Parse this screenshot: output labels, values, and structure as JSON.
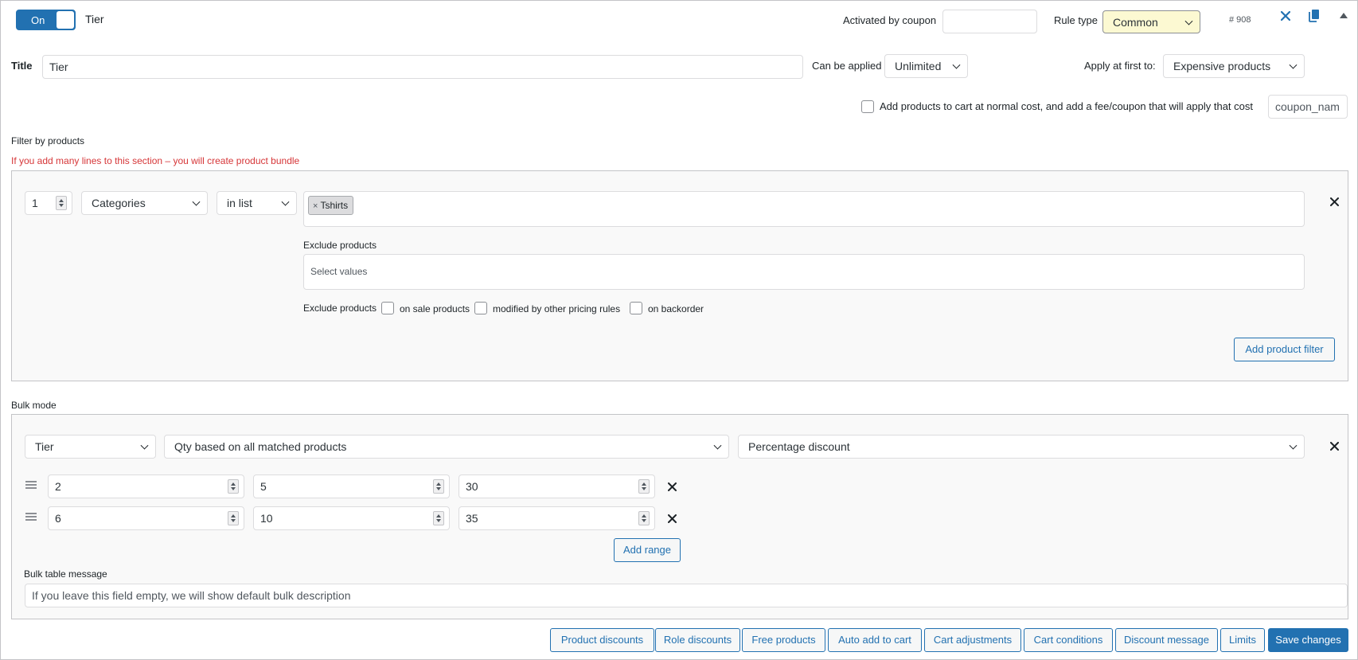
{
  "header": {
    "toggle_label": "On",
    "rule_name": "Tier",
    "activated_by_coupon_label": "Activated by coupon",
    "activated_by_coupon_value": "",
    "rule_type_label": "Rule type",
    "rule_type_value": "Common",
    "rule_id": "# 908"
  },
  "title_row": {
    "title_label": "Title",
    "title_value": "Tier",
    "can_be_applied_label": "Can be applied",
    "can_be_applied_value": "Unlimited",
    "apply_first_label": "Apply at first to:",
    "apply_first_value": "Expensive products"
  },
  "fee_row": {
    "checkbox_label": "Add products to cart at normal cost, and add a fee/coupon that will apply that cost",
    "coupon_placeholder": "coupon_nam"
  },
  "filter": {
    "section_label": "Filter by products",
    "warning": "If you add many lines to this section – you will create product bundle",
    "qty_value": "1",
    "type_value": "Categories",
    "method_value": "in list",
    "tags": [
      {
        "remove": "×",
        "label": "Tshirts"
      }
    ],
    "exclude_products_label": "Exclude products",
    "exclude_placeholder": "Select values",
    "exclude_products_inline_label": "Exclude products",
    "exclude_options": [
      "on sale products",
      "modified by other pricing rules",
      "on backorder"
    ],
    "add_filter_button": "Add product filter"
  },
  "bulk": {
    "section_label": "Bulk mode",
    "mode_value": "Tier",
    "qty_based_value": "Qty based on all matched products",
    "discount_type_value": "Percentage discount",
    "ranges": [
      {
        "from": "2",
        "to": "5",
        "value": "30"
      },
      {
        "from": "6",
        "to": "10",
        "value": "35"
      }
    ],
    "add_range_button": "Add range",
    "table_message_label": "Bulk table message",
    "table_message_placeholder": "If you leave this field empty, we will show default bulk description"
  },
  "footer": {
    "buttons": [
      "Product discounts",
      "Role discounts",
      "Free products",
      "Auto add to cart",
      "Cart adjustments",
      "Cart conditions",
      "Discount message",
      "Limits"
    ],
    "save_button": "Save changes"
  },
  "icons": {
    "close": "close-icon",
    "copy": "copy-icon",
    "collapse": "collapse-icon",
    "remove": "remove-icon",
    "drag": "drag-handle-icon"
  },
  "colors": {
    "accent": "#2271b1",
    "warning": "#d63638",
    "rule_type_bg": "#fcf9d2"
  }
}
